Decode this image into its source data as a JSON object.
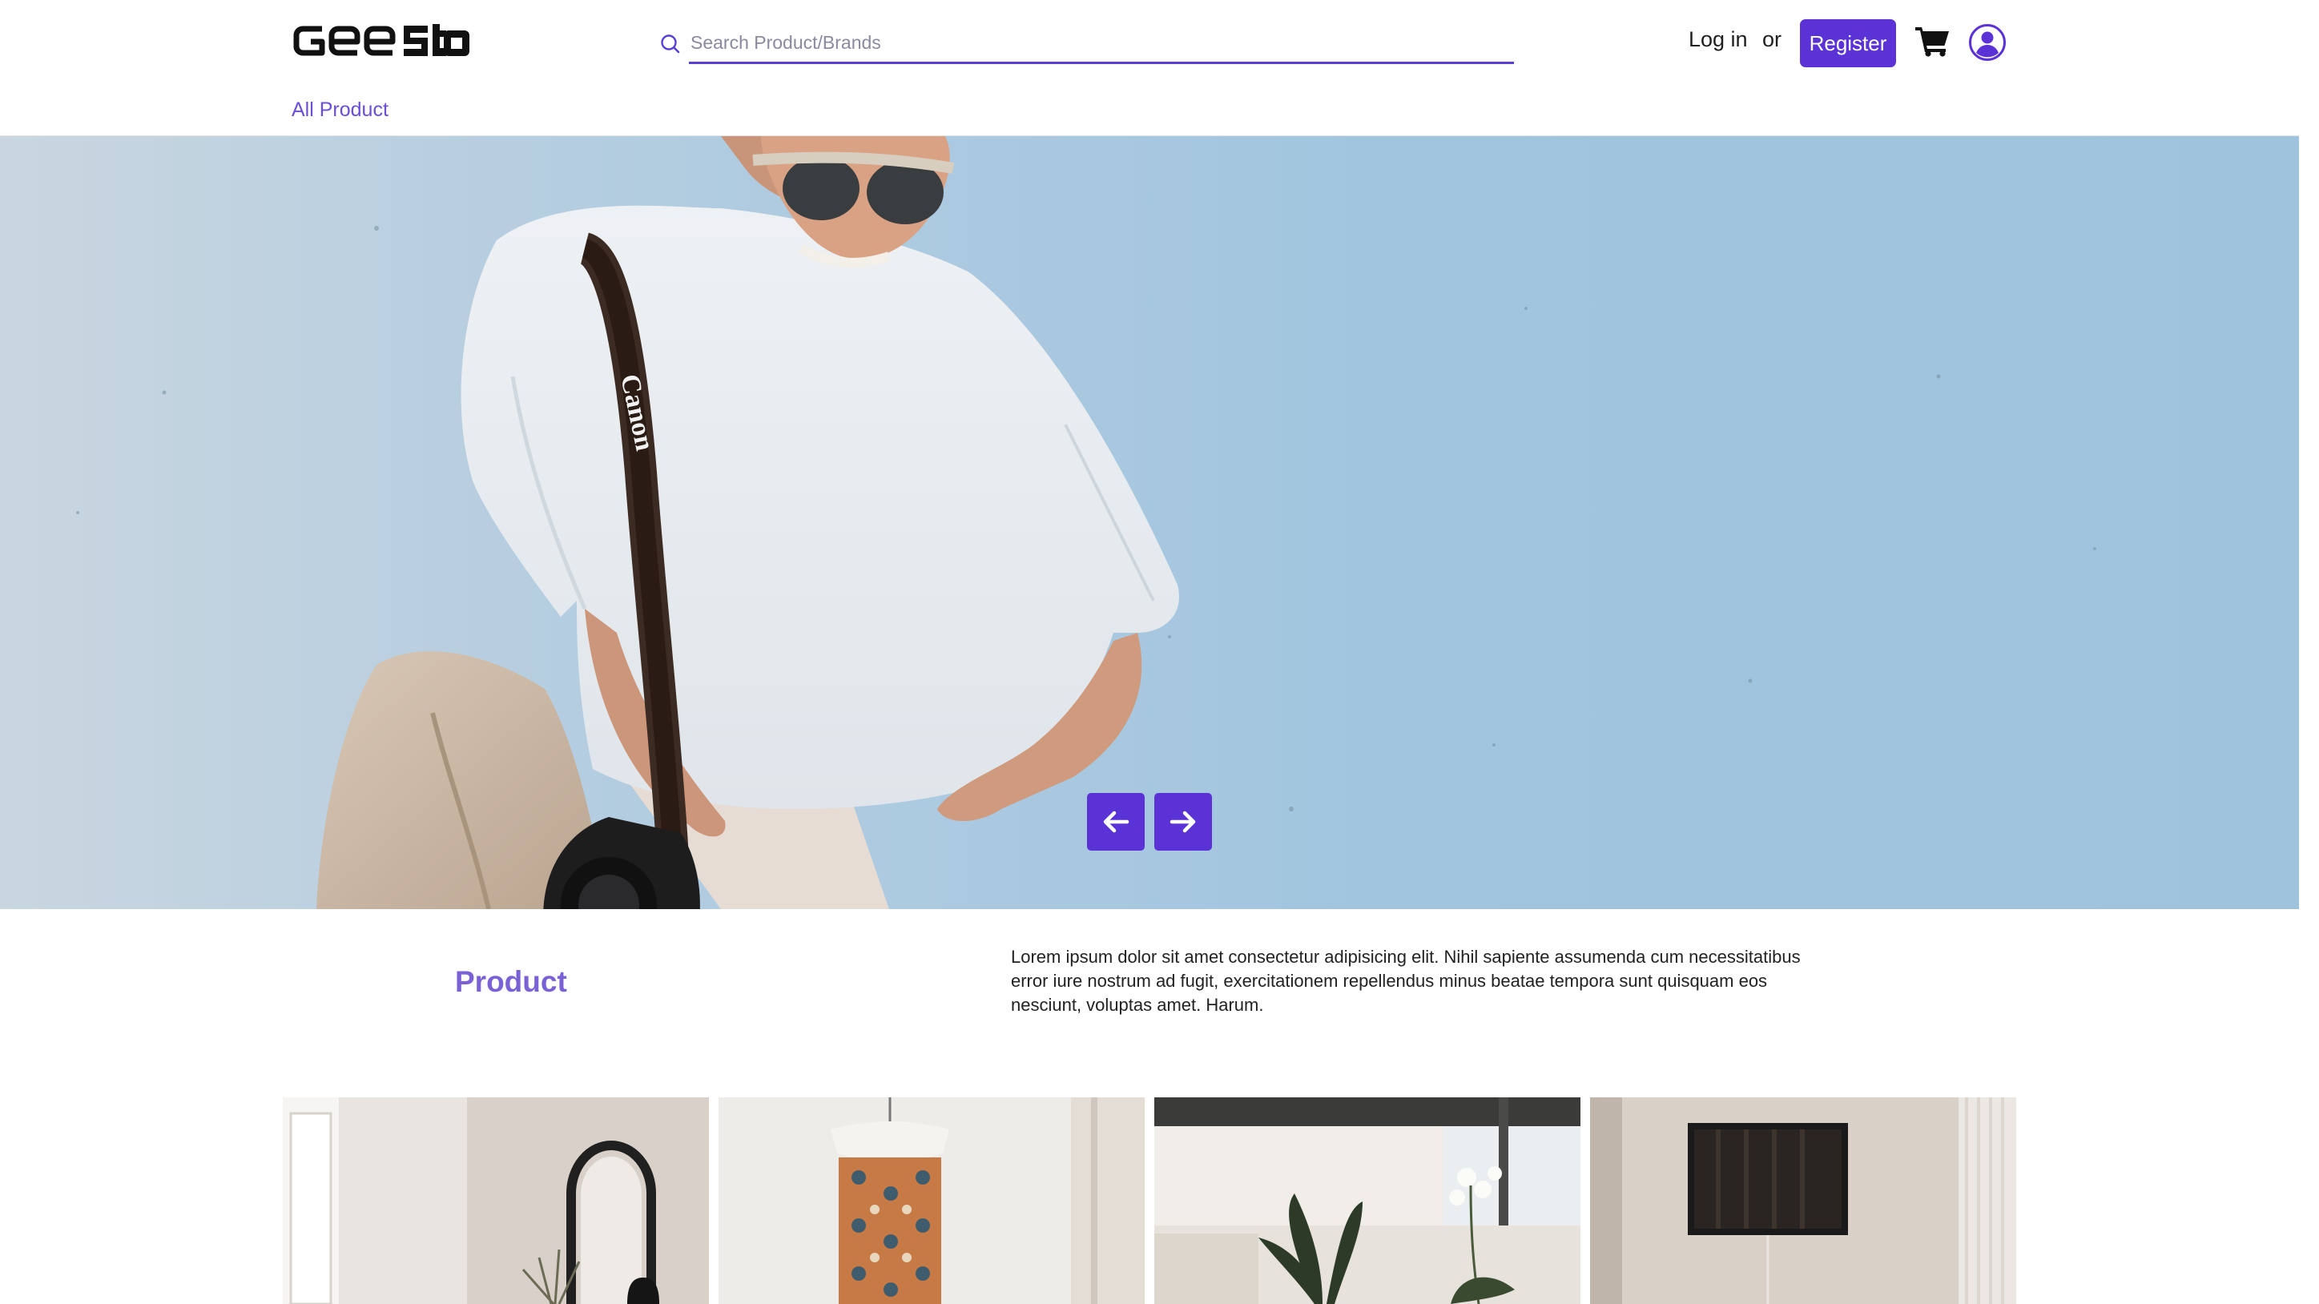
{
  "header": {
    "logo_text": "GeeStore",
    "search": {
      "placeholder": "Search Product/Brands",
      "value": ""
    },
    "login_label": "Log in",
    "or_label": "or",
    "register_label": "Register",
    "cart_icon": "cart-icon",
    "user_icon": "user-icon"
  },
  "nav": {
    "items": [
      {
        "label": "All Product"
      }
    ]
  },
  "hero": {
    "strap_text": "Canon",
    "prev_icon": "arrow-left-icon",
    "next_icon": "arrow-right-icon"
  },
  "product_section": {
    "title": "Product",
    "description": "Lorem ipsum dolor sit amet consectetur adipisicing elit. Nihil sapiente assumenda cum necessitatibus error iure nostrum ad fugit, exercitationem repellendus minus beatae tempora sunt quisquam eos nesciunt, voluptas amet. Harum."
  },
  "colors": {
    "brand": "#5b32d6",
    "link": "#6a4fd6",
    "title": "#7a62d6",
    "text": "#222222"
  }
}
